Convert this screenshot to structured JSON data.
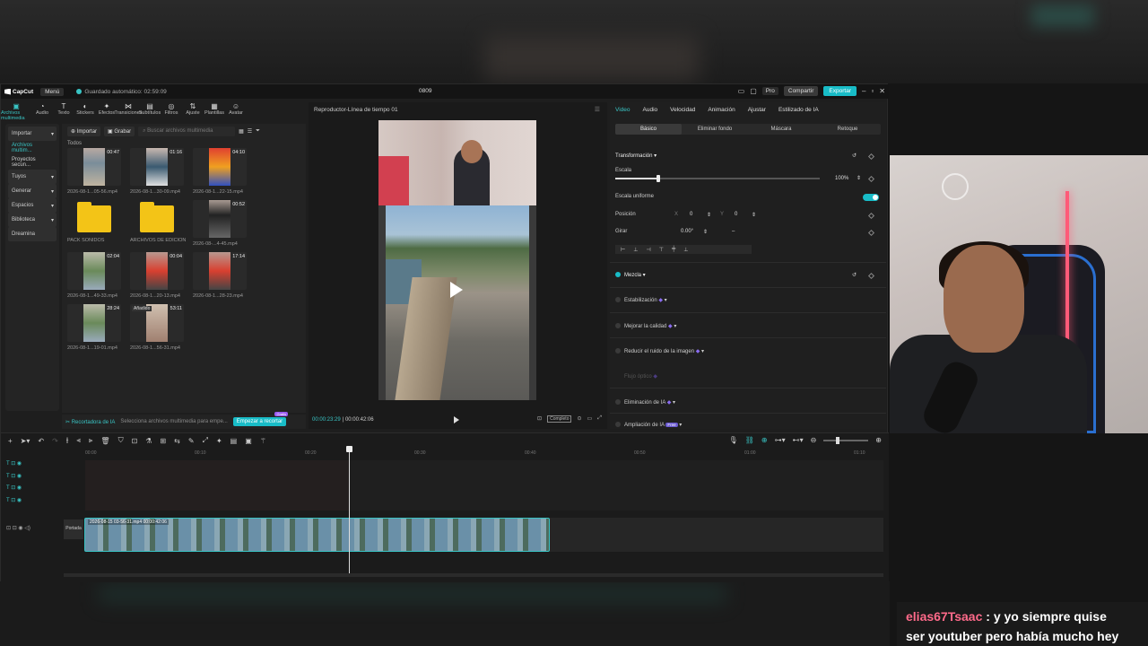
{
  "titlebar": {
    "app_name": "CapCut",
    "menu_label": "Menú",
    "autosave": "Guardado automático: 02:59:09",
    "project_name": "0809",
    "pro_label": "Pro",
    "share_label": "Compartir",
    "export_label": "Exportar"
  },
  "toolbar": [
    {
      "label": "Archivos multimedia",
      "icon": "media-icon"
    },
    {
      "label": "Audio",
      "icon": "audio-icon"
    },
    {
      "label": "Texto",
      "icon": "text-icon"
    },
    {
      "label": "Stickers",
      "icon": "sticker-icon"
    },
    {
      "label": "Efectos",
      "icon": "effects-icon"
    },
    {
      "label": "Transiciones",
      "icon": "transitions-icon"
    },
    {
      "label": "Subtítulos",
      "icon": "subtitles-icon"
    },
    {
      "label": "Filtros",
      "icon": "filters-icon"
    },
    {
      "label": "Ajuste",
      "icon": "adjust-icon"
    },
    {
      "label": "Plantillas",
      "icon": "templates-icon"
    },
    {
      "label": "Avatar",
      "icon": "avatar-icon"
    }
  ],
  "sidebar": [
    {
      "label": "Importar"
    },
    {
      "label": "Archivos multim..."
    },
    {
      "label": "Proyectos secun..."
    },
    {
      "label": "Tuyos"
    },
    {
      "label": "Generar"
    },
    {
      "label": "Espacios"
    },
    {
      "label": "Biblioteca"
    },
    {
      "label": "Dreamina"
    }
  ],
  "media": {
    "import_label": "Importar",
    "record_label": "Grabar",
    "search_placeholder": "Buscar archivos multimedia",
    "all_label": "Todos",
    "items": [
      {
        "name": "2026-08-1...05-56.mp4",
        "duration": "00:47"
      },
      {
        "name": "2026-08-1...30-09.mp4",
        "duration": "01:16"
      },
      {
        "name": "2026-08-1...22-15.mp4",
        "duration": "04:10"
      },
      {
        "name": "PACK SONIDOS",
        "duration": ""
      },
      {
        "name": "ARCHIVOS DE EDICION",
        "duration": ""
      },
      {
        "name": "2026-08-...4-45.mp4",
        "duration": "00:52"
      },
      {
        "name": "2026-08-1...49-33.mp4",
        "duration": "02:04"
      },
      {
        "name": "2026-08-1...20-13.mp4",
        "duration": "00:04"
      },
      {
        "name": "2026-08-1...28-23.mp4",
        "duration": "17:14"
      },
      {
        "name": "2026-08-1...19-01.mp4",
        "duration": "28:24"
      },
      {
        "name": "2026-08-1...56-31.mp4",
        "duration": "53:11"
      }
    ],
    "added_label": "Añadido"
  },
  "ai_bar": {
    "title": "Recortadora de IA",
    "hint": "Selecciona archivos multimedia para empe...",
    "button": "Empezar a recortar",
    "badge": "Gratis"
  },
  "player": {
    "title": "Reproductor-Línea de tiempo 01",
    "caption": "...",
    "current_time": "00:00:23:29",
    "total_time": "00:00:42:06",
    "full_label": "Completo"
  },
  "props": {
    "tabs": [
      "Video",
      "Audio",
      "Velocidad",
      "Animación",
      "Ajustar",
      "Estilizado de IA"
    ],
    "subtabs": [
      "Básico",
      "Eliminar fondo",
      "Máscara",
      "Retoque"
    ],
    "transform_label": "Transformación",
    "scale_label": "Escala",
    "scale_value": "100%",
    "uniform_label": "Escala uniforme",
    "position_label": "Posición",
    "pos_x_label": "X",
    "pos_x": "0",
    "pos_y_label": "Y",
    "pos_y": "0",
    "rotate_label": "Girar",
    "rotate_value": "0.00°",
    "rotate_extra": "–",
    "blend_label": "Mezcla",
    "stabilize_label": "Estabilización",
    "quality_label": "Mejorar la calidad",
    "noise_label": "Reducir el ruido de la imagen",
    "optical_label": "Flujo óptico",
    "ai_remove_label": "Eliminación de IA",
    "ai_expand_label": "Ampliación de IA",
    "ai_expand_badge": "Free"
  },
  "timeline": {
    "ruler": [
      "00:00",
      "00:10",
      "00:20",
      "00:30",
      "00:40",
      "00:50",
      "01:00",
      "01:10"
    ],
    "clip_label": "2026-08-15 03-56-31.mp4  00:00:42:06",
    "cover_label": "Portada"
  },
  "chat": {
    "user": "elias67Tsaac",
    "line1": " : y yo siempre quise",
    "line2": "ser youtuber pero había mucho hey"
  }
}
